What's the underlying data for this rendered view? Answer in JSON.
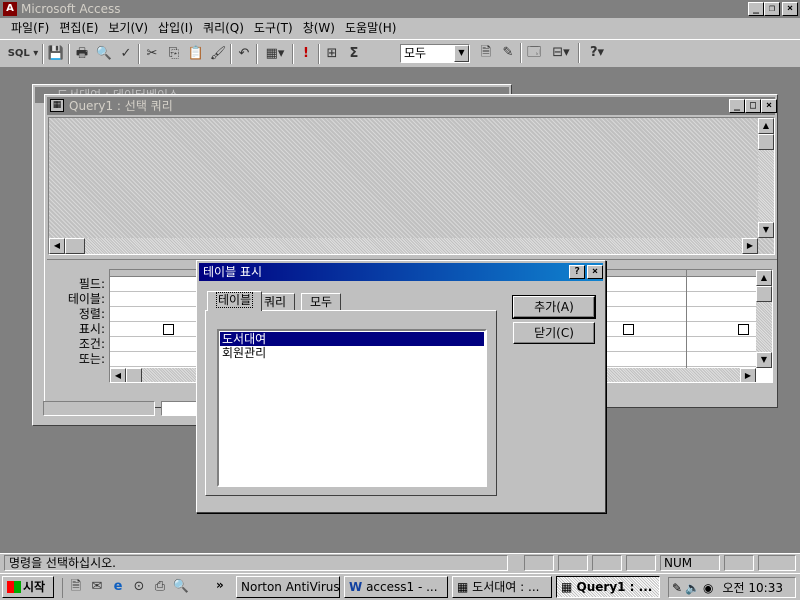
{
  "app": {
    "title": "Microsoft Access"
  },
  "menu": [
    "파일(F)",
    "편집(E)",
    "보기(V)",
    "삽입(I)",
    "쿼리(Q)",
    "도구(T)",
    "창(W)",
    "도움말(H)"
  ],
  "toolbar": {
    "sql_label": "SQL",
    "combo_value": "모두",
    "sigma": "Σ",
    "exclaim": "!",
    "help": "?"
  },
  "back_window": {
    "title": "도서대여 : 데이터베이스"
  },
  "query_window": {
    "title": "Query1 : 선택 쿼리",
    "grid_labels": [
      "필드:",
      "테이블:",
      "정렬:",
      "표시:",
      "조건:",
      "또는:"
    ]
  },
  "dialog": {
    "title": "테이블 표시",
    "help": "?",
    "close": "×",
    "tabs": [
      "테이블",
      "쿼리",
      "모두"
    ],
    "list": [
      "도서대여",
      "회원관리"
    ],
    "selected_index": 0,
    "add_button": "추가(A)",
    "close_button": "닫기(C)"
  },
  "status": {
    "text": "명령을 선택하십시오.",
    "num": "NUM"
  },
  "taskbar": {
    "start": "시작",
    "more": "»",
    "tasks": [
      "Norton AntiVirus",
      "access1 - ...",
      "도서대여 : ...",
      "Query1 : ..."
    ],
    "clock": "오전 10:33"
  }
}
